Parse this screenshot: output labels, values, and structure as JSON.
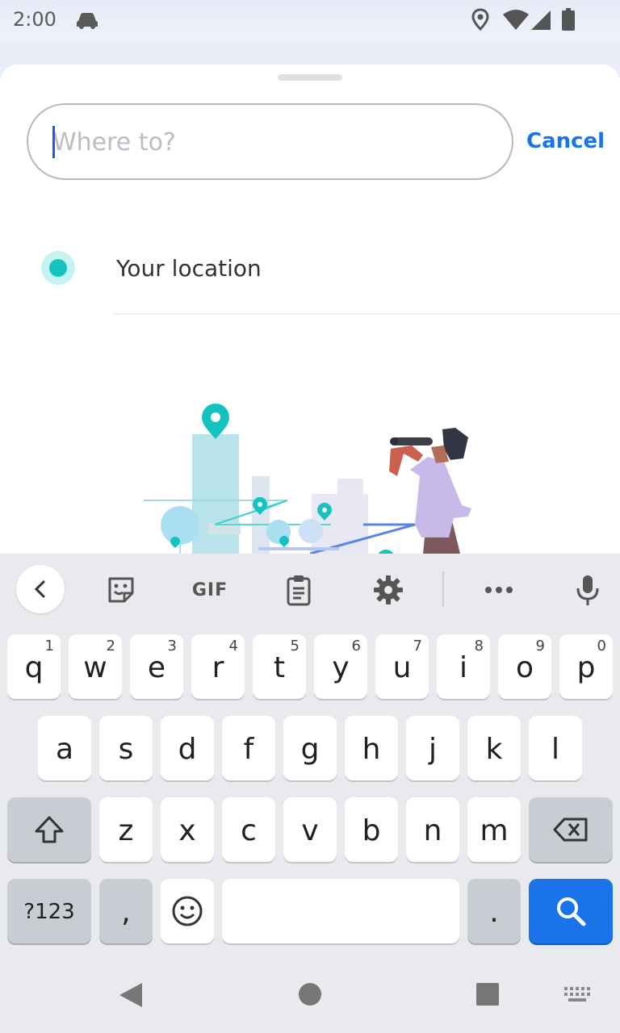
{
  "status_bar": {
    "time": "2:00",
    "icons": [
      "car-icon",
      "location-icon",
      "wifi-icon",
      "signal-icon",
      "battery-icon"
    ]
  },
  "search": {
    "placeholder": "Where to?",
    "value": "",
    "cancel_label": "Cancel"
  },
  "location": {
    "label": "Your location",
    "accent": "#14c3c0"
  },
  "keyboard": {
    "toolbar": {
      "gif_label": "GIF"
    },
    "row1": [
      {
        "key": "q",
        "hint": "1"
      },
      {
        "key": "w",
        "hint": "2"
      },
      {
        "key": "e",
        "hint": "3"
      },
      {
        "key": "r",
        "hint": "4"
      },
      {
        "key": "t",
        "hint": "5"
      },
      {
        "key": "y",
        "hint": "6"
      },
      {
        "key": "u",
        "hint": "7"
      },
      {
        "key": "i",
        "hint": "8"
      },
      {
        "key": "o",
        "hint": "9"
      },
      {
        "key": "p",
        "hint": "0"
      }
    ],
    "row2": [
      "a",
      "s",
      "d",
      "f",
      "g",
      "h",
      "j",
      "k",
      "l"
    ],
    "row3": [
      "z",
      "x",
      "c",
      "v",
      "b",
      "n",
      "m"
    ],
    "symbols_label": "?123",
    "comma_label": ",",
    "period_label": ".",
    "search_key_color": "#1a73e8"
  }
}
